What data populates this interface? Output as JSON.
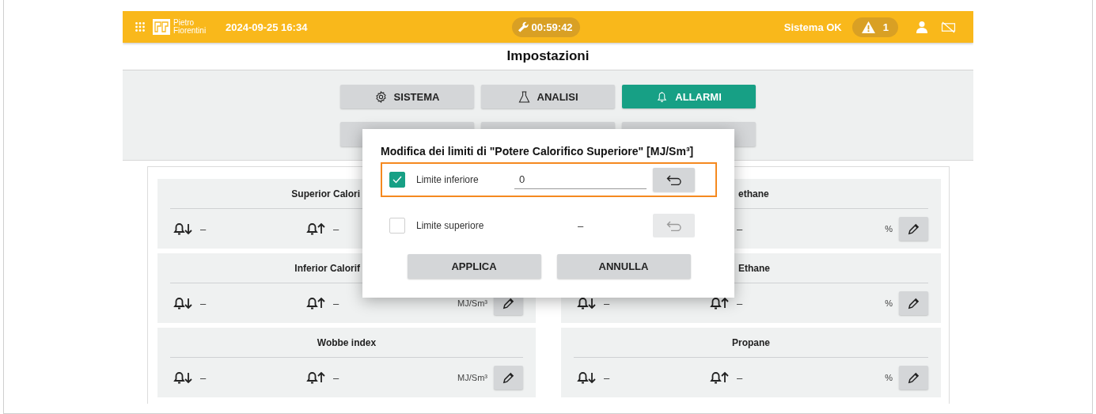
{
  "topbar": {
    "brand": "Pietro Fiorentini",
    "datetime": "2024-09-25 16:34",
    "timer": "00:59:42",
    "status": "Sistema OK",
    "alerts": "1"
  },
  "page_title": "Impostazioni",
  "tabs": [
    {
      "label": "SISTEMA",
      "kind": "system",
      "selected": false
    },
    {
      "label": "ANALISI",
      "kind": "analysis",
      "selected": false
    },
    {
      "label": "ALLARMI",
      "kind": "alarms",
      "selected": true
    }
  ],
  "cards_left": [
    {
      "title": "Superior Calori",
      "low": "–",
      "high": "–"
    },
    {
      "title": "Inferior Calorif",
      "low": "–",
      "high": "–",
      "unit": "MJ/Sm³"
    },
    {
      "title": "Wobbe index",
      "low": "–",
      "high": "–",
      "unit": "MJ/Sm³"
    }
  ],
  "cards_right": [
    {
      "title": "ethane",
      "high": "–",
      "unit": "%"
    },
    {
      "title": "Ethane",
      "low": "–",
      "high": "–",
      "unit": "%"
    },
    {
      "title": "Propane",
      "low": "–",
      "high": "–",
      "unit": "%"
    }
  ],
  "dialog": {
    "title": "Modifica dei limiti di \"Potere Calorifico Superiore\" [MJ/Sm³]",
    "limits": [
      {
        "label": "Limite inferiore",
        "checked": true,
        "value": "0",
        "highlighted": true
      },
      {
        "label": "Limite superiore",
        "checked": false,
        "value": "–",
        "highlighted": false
      }
    ],
    "buttons": [
      "APPLICA",
      "ANNULLA"
    ]
  }
}
